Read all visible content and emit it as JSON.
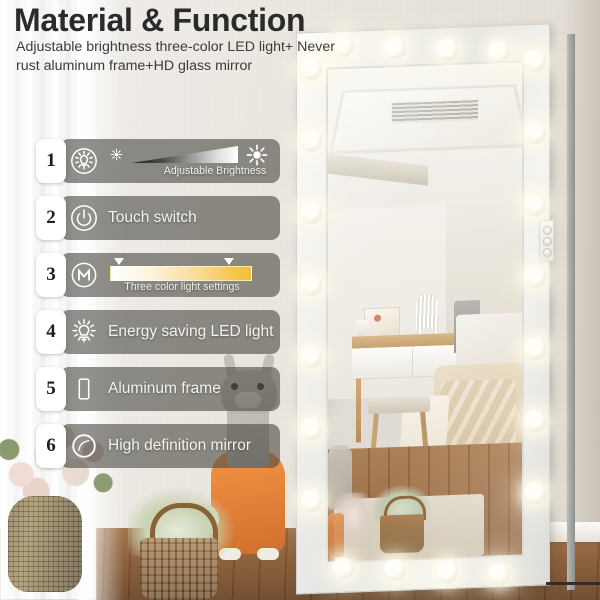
{
  "header": {
    "title": "Material & Function",
    "subtitle": "Adjustable brightness three-color LED light+ Never rust aluminum frame+HD glass mirror"
  },
  "features": [
    {
      "number": "1",
      "icon": "bulb-circle-icon",
      "label": "",
      "caption": "Adjustable Brightness",
      "control": "brightness-slider"
    },
    {
      "number": "2",
      "icon": "power-circle-icon",
      "label": "Touch switch",
      "caption": "",
      "control": "none"
    },
    {
      "number": "3",
      "icon": "m-circle-icon",
      "label": "",
      "caption": "Three color light settings",
      "control": "color-slider"
    },
    {
      "number": "4",
      "icon": "led-bulb-rays-icon",
      "label": "Energy saving LED light",
      "caption": "",
      "control": "none"
    },
    {
      "number": "5",
      "icon": "frame-rect-icon",
      "label": "Aluminum frame",
      "caption": "",
      "control": "none"
    },
    {
      "number": "6",
      "icon": "mirror-circle-icon",
      "label": "High definition mirror",
      "caption": "",
      "control": "none"
    }
  ],
  "product": {
    "name": "hollywood-vanity-floor-mirror",
    "bulb_count_top": 4,
    "bulb_count_left": 7,
    "bulb_count_right": 7,
    "bulb_count_bottom": 4,
    "touch_button_count": 3
  },
  "colors": {
    "pill_bg": "#4e4c46",
    "badge_bg": "#ffffff",
    "headline": "#2b2b2b",
    "amber": "#f5c54a",
    "bulb_glow": "#fffcec",
    "wall": "#eae5dd",
    "floor": "#8c6039"
  },
  "scene": {
    "foreground_items": [
      "flower-vase",
      "woven-basket",
      "llama-plush",
      "sheer-curtain"
    ],
    "reflection_items": [
      "ceiling-vent",
      "vanity-desk",
      "table-lamp",
      "stool",
      "bed",
      "throw-blanket",
      "area-rug"
    ]
  }
}
